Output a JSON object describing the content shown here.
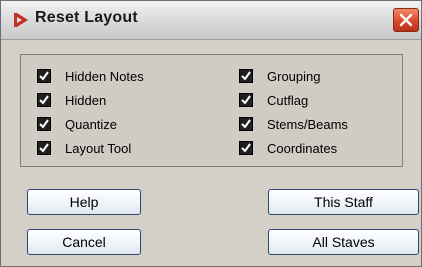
{
  "window": {
    "title": "Reset Layout",
    "app_icon": "cubase-arrow-icon",
    "close_icon": "close-icon"
  },
  "options": {
    "left": [
      {
        "label": "Hidden Notes",
        "checked": true
      },
      {
        "label": "Hidden",
        "checked": true
      },
      {
        "label": "Quantize",
        "checked": true
      },
      {
        "label": "Layout Tool",
        "checked": true
      }
    ],
    "right": [
      {
        "label": "Grouping",
        "checked": true
      },
      {
        "label": "Cutflag",
        "checked": true
      },
      {
        "label": "Stems/Beams",
        "checked": true
      },
      {
        "label": "Coordinates",
        "checked": true
      }
    ]
  },
  "buttons": {
    "help": "Help",
    "cancel": "Cancel",
    "this_staff": "This Staff",
    "all_staves": "All Staves"
  },
  "colors": {
    "app_icon": "#c4302b",
    "close_button": "#d9492a",
    "dialog_bg": "#d4d0c8"
  }
}
